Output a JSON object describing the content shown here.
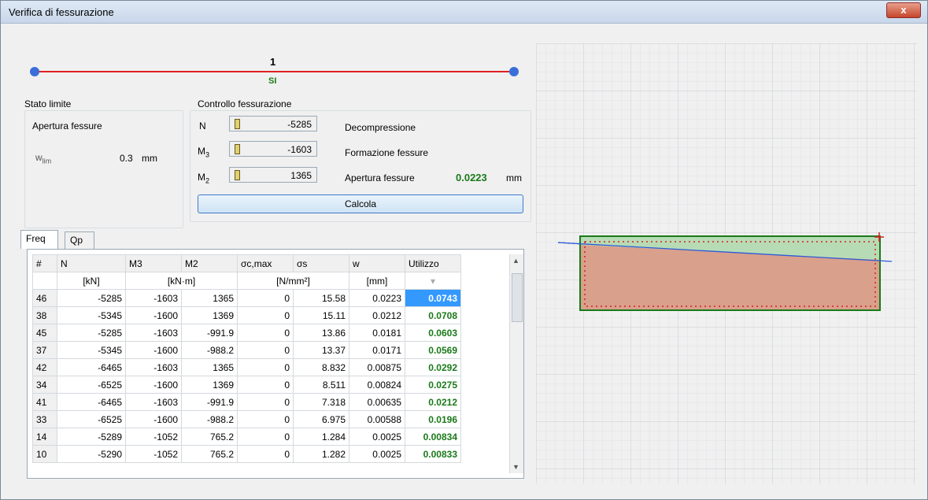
{
  "window": {
    "title": "Verifica di fessurazione",
    "close_label": "x"
  },
  "beam": {
    "label": "1",
    "status": "SI",
    "status_color": "#1a7a1a"
  },
  "stato_limite": {
    "heading": "Stato limite",
    "type": "Apertura fessure",
    "wlim_label": "w",
    "wlim_sub": "lim",
    "wlim_value": "0.3",
    "wlim_unit": "mm"
  },
  "controllo": {
    "heading": "Controllo fessurazione",
    "rows": [
      {
        "label": "N",
        "sub": "",
        "value": "-5285",
        "desc": "Decompressione"
      },
      {
        "label": "M",
        "sub": "3",
        "value": "-1603",
        "desc": "Formazione fessure"
      },
      {
        "label": "M",
        "sub": "2",
        "value": "1365",
        "desc": "Apertura fessure"
      }
    ],
    "apertura_result": "0.0223",
    "apertura_unit": "mm"
  },
  "calcola_label": "Calcola",
  "tabs": [
    {
      "label": "Freq"
    },
    {
      "label": "Qp"
    }
  ],
  "table": {
    "headers": [
      "#",
      "N",
      "M3",
      "M2",
      "σc,max",
      "σs",
      "w",
      "Utilizzo"
    ],
    "units": [
      "",
      "[kN]",
      "[kN·m]",
      "",
      "[N/mm²]",
      "",
      "[mm]",
      ""
    ],
    "rows": [
      [
        "46",
        "-5285",
        "-1603",
        "1365",
        "0",
        "15.58",
        "0.0223",
        "0.0743"
      ],
      [
        "38",
        "-5345",
        "-1600",
        "1369",
        "0",
        "15.11",
        "0.0212",
        "0.0708"
      ],
      [
        "45",
        "-5285",
        "-1603",
        "-991.9",
        "0",
        "13.86",
        "0.0181",
        "0.0603"
      ],
      [
        "37",
        "-5345",
        "-1600",
        "-988.2",
        "0",
        "13.37",
        "0.0171",
        "0.0569"
      ],
      [
        "42",
        "-6465",
        "-1603",
        "1365",
        "0",
        "8.832",
        "0.00875",
        "0.0292"
      ],
      [
        "34",
        "-6525",
        "-1600",
        "1369",
        "0",
        "8.511",
        "0.00824",
        "0.0275"
      ],
      [
        "41",
        "-6465",
        "-1603",
        "-991.9",
        "0",
        "7.318",
        "0.00635",
        "0.0212"
      ],
      [
        "33",
        "-6525",
        "-1600",
        "-988.2",
        "0",
        "6.975",
        "0.00588",
        "0.0196"
      ],
      [
        "14",
        "-5289",
        "-1052",
        "765.2",
        "0",
        "1.284",
        "0.0025",
        "0.00834"
      ],
      [
        "10",
        "-5290",
        "-1052",
        "765.2",
        "0",
        "1.282",
        "0.0025",
        "0.00833"
      ]
    ]
  },
  "colors": {
    "accent": "#3a6ed8",
    "beam": "#e02020",
    "ok": "#1a7a1a",
    "section_fill": "#d9a08c",
    "compressed": "#b7dcb5"
  }
}
